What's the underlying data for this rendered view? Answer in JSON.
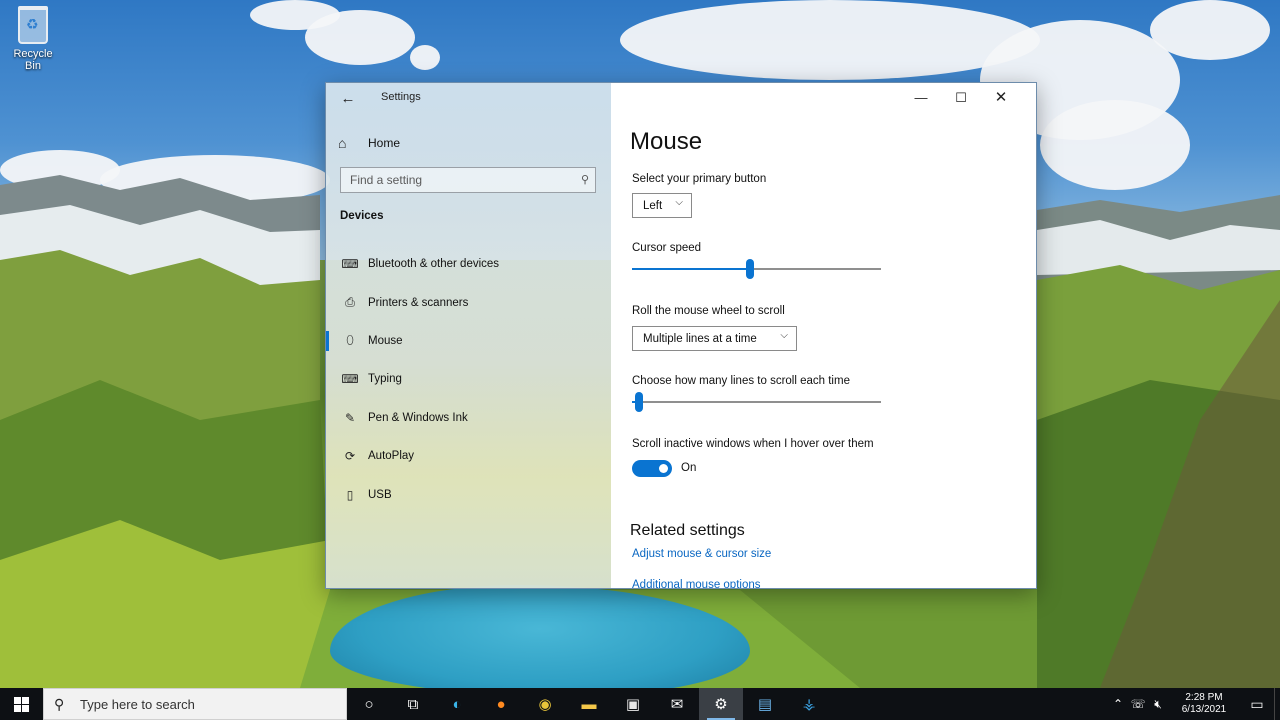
{
  "desktop": {
    "recycle_bin_label": "Recycle Bin"
  },
  "window": {
    "title": "Settings",
    "controls": {
      "minimize": "—",
      "maximize": "☐",
      "close": "✕"
    }
  },
  "nav": {
    "home_label": "Home",
    "search_placeholder": "Find a setting",
    "section_title": "Devices",
    "items": [
      {
        "label": "Bluetooth & other devices",
        "icon": "keyboard-device-icon",
        "glyph": "⌨",
        "active": false
      },
      {
        "label": "Printers & scanners",
        "icon": "printer-icon",
        "glyph": "⎙",
        "active": false
      },
      {
        "label": "Mouse",
        "icon": "mouse-icon",
        "glyph": "⬯",
        "active": true
      },
      {
        "label": "Typing",
        "icon": "keyboard-icon",
        "glyph": "⌨",
        "active": false
      },
      {
        "label": "Pen & Windows Ink",
        "icon": "pen-icon",
        "glyph": "✎",
        "active": false
      },
      {
        "label": "AutoPlay",
        "icon": "autoplay-icon",
        "glyph": "⟳",
        "active": false
      },
      {
        "label": "USB",
        "icon": "usb-icon",
        "glyph": "▯",
        "active": false
      }
    ]
  },
  "content": {
    "title": "Mouse",
    "primary_button": {
      "label": "Select your primary button",
      "value": "Left"
    },
    "cursor_speed": {
      "label": "Cursor speed",
      "value_fraction": 0.475
    },
    "scroll_wheel": {
      "label": "Roll the mouse wheel to scroll",
      "value": "Multiple lines at a time"
    },
    "lines_to_scroll": {
      "label": "Choose how many lines to scroll each time",
      "value_fraction": 0.03
    },
    "scroll_inactive": {
      "label": "Scroll inactive windows when I hover over them",
      "state": "On"
    },
    "related_title": "Related settings",
    "links": [
      "Adjust mouse & cursor size",
      "Additional mouse options"
    ]
  },
  "taskbar": {
    "search_placeholder": "Type here to search",
    "time": "2:28 PM",
    "date": "6/13/2021"
  },
  "colors": {
    "accent": "#0a74d1",
    "link": "#0a67c2",
    "taskbar": "#0d1014"
  }
}
